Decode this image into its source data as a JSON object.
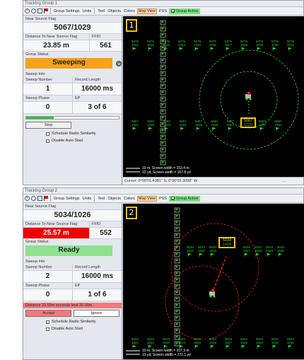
{
  "colors": {
    "sweeping": "#f8a11a",
    "ready": "#8fe08f",
    "danger": "#f00000",
    "marker_green": "#29d629",
    "ring_green": "#29d629",
    "ring_red": "#e12121",
    "highlight": "#f0c419"
  },
  "toolbar": {
    "group_settings": "Group Settings",
    "units": "Units",
    "text": "Text",
    "objects": "Objects",
    "colors": "Colors",
    "map_view": "Map View",
    "pss": "PSS",
    "group_active": "Group Active"
  },
  "group1": {
    "title": "Tracking Group 1",
    "badge": "1",
    "near_flag_label": "Near Source Flag",
    "near_flag_value": "5067/1029",
    "distance_label": "Distance To Near Source Flag",
    "distance_value": "23.85 m",
    "ffid_label": "FFID",
    "ffid_value": "561",
    "status_label": "Group Status",
    "status_value": "Sweeping",
    "sweep_info_label": "Sweep Info",
    "sweep_number_label": "Sweep Number",
    "sweep_number_value": "1",
    "record_length_label": "Record Length",
    "record_length_value": "16000 ms",
    "sweep_phase_label": "Sweep Phase",
    "sweep_phase_value": "0",
    "ep_label": "EP",
    "ep_value": "3 of 6",
    "sweep_progress": 0.3,
    "stop_button": "Stop",
    "schedule_radio": "Schedule Radio Similarity",
    "disable_auto": "Disable Auto Start",
    "scale_line1": "10 m, Screen width = 153.4 m",
    "scale_line2": "10 yd, Screen width = 167.8 yd",
    "cursor_text": "Cursor: 0°00'01.4381\" S, 0°00'02.3098\" W.",
    "cursor_dots": "...",
    "selected_flag_top": "5067",
    "selected_flag_bottom": "1029",
    "flags_row_top": [
      {
        "a": "5076",
        "b": "1021"
      },
      {
        "a": "5076",
        "b": "1022"
      },
      {
        "a": "5076",
        "b": "1023"
      },
      {
        "a": "5076",
        "b": "1024"
      },
      {
        "a": "5076",
        "b": "1025"
      },
      {
        "a": "5076",
        "b": "1026"
      },
      {
        "a": "5076",
        "b": "1027"
      },
      {
        "a": "5076",
        "b": "1028"
      },
      {
        "a": "5076",
        "b": "1029"
      },
      {
        "a": "5076",
        "b": "1030"
      },
      {
        "a": "5076",
        "b": "1031"
      }
    ],
    "flags_row_bottom": [
      {
        "a": "5067",
        "b": "1021"
      },
      {
        "a": "5067",
        "b": "1022"
      },
      {
        "a": "5067",
        "b": "1023"
      },
      {
        "a": "5067",
        "b": "1024"
      },
      {
        "a": "5067",
        "b": "1025"
      },
      {
        "a": "5067",
        "b": "1026"
      },
      {
        "a": "5067",
        "b": "1027"
      },
      {
        "a": "5067",
        "b": "1028"
      },
      {
        "a": "5067",
        "b": "1030"
      },
      {
        "a": "5067",
        "b": "1031"
      }
    ]
  },
  "group2": {
    "title": "Tracking Group 2",
    "badge": "2",
    "near_flag_label": "Near Source Flag",
    "near_flag_value": "5034/1026",
    "distance_label": "Distance To Near Source Flag",
    "distance_value": "25.57 m",
    "ffid_label": "FFID",
    "ffid_value": "552",
    "status_label": "Group Status",
    "status_value": "Ready",
    "sweep_info_label": "Sweep Info",
    "sweep_number_label": "Sweep Number",
    "sweep_number_value": "2",
    "record_length_label": "Record Length",
    "record_length_value": "16000 ms",
    "sweep_phase_label": "Sweep Phase",
    "sweep_phase_value": "0",
    "ep_label": "EP",
    "ep_value": "1 of 6",
    "warning": "Distance 23.59m exceeds limit 20.00m.",
    "accept_button": "Accept",
    "ignore_button": "Ignore",
    "schedule_radio": "Schedule Radio Similarity",
    "disable_auto": "Disable Auto Start",
    "scale_line1": "10 m, Screen width = 157.3 m",
    "scale_line2": "10 yd, Screen width = 172.1 yd",
    "selected_flag_top": "5034",
    "selected_flag_bottom": "1026",
    "flags_row_top": [
      {
        "a": "5034",
        "b": "1021"
      },
      {
        "a": "5034",
        "b": "1022"
      },
      {
        "a": "5034",
        "b": "1023"
      },
      {
        "a": "5034",
        "b": "1024"
      },
      {
        "a": "5034",
        "b": "1025"
      },
      {
        "a": "5034",
        "b": "1027"
      },
      {
        "a": "5034",
        "b": "1028"
      },
      {
        "a": "5034",
        "b": "1029"
      },
      {
        "a": "5034",
        "b": "1030"
      }
    ],
    "flags_row_bottom": [
      {
        "a": "5023",
        "b": "1021"
      },
      {
        "a": "5023",
        "b": "1022"
      },
      {
        "a": "5023",
        "b": "1023"
      },
      {
        "a": "5023",
        "b": "1024"
      },
      {
        "a": "5023",
        "b": "1025"
      },
      {
        "a": "5023",
        "b": "1026"
      },
      {
        "a": "5023",
        "b": "1027"
      },
      {
        "a": "5023",
        "b": "1028"
      },
      {
        "a": "5023",
        "b": "1029"
      },
      {
        "a": "5023",
        "b": "1030"
      },
      {
        "a": "5023",
        "b": "1031"
      }
    ]
  }
}
